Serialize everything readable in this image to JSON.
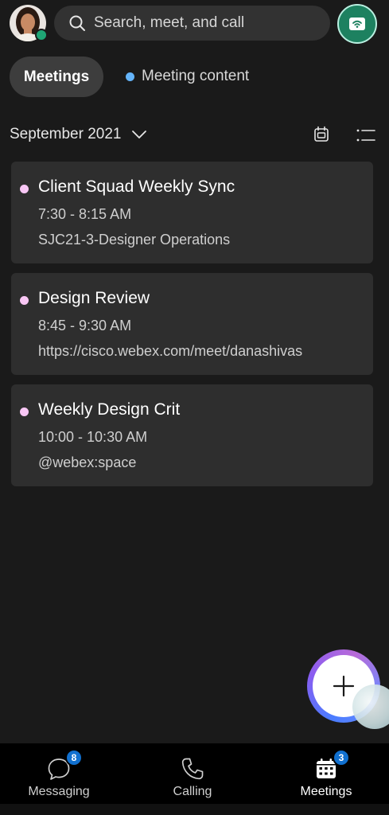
{
  "header": {
    "search_placeholder": "Search, meet, and call"
  },
  "tabs": {
    "meetings_label": "Meetings",
    "content_label": "Meeting content"
  },
  "calendar": {
    "month_label": "September 2021"
  },
  "meetings": [
    {
      "title": "Client Squad Weekly Sync",
      "time": "7:30 - 8:15 AM",
      "location": "SJC21-3-Designer Operations"
    },
    {
      "title": "Design Review",
      "time": "8:45 - 9:30 AM",
      "location": "https://cisco.webex.com/meet/danashivas"
    },
    {
      "title": "Weekly Design Crit",
      "time": "10:00 - 10:30 AM",
      "location": "@webex:space"
    }
  ],
  "bottom_nav": {
    "messaging_label": "Messaging",
    "messaging_badge": "8",
    "calling_label": "Calling",
    "meetings_label": "Meetings",
    "meetings_badge": "3"
  },
  "colors": {
    "background": "#1a1a1a",
    "card": "#2e2e2e",
    "meeting_dot": "#f9c7f5",
    "content_dot": "#64b4fa",
    "presence": "#1fa575",
    "badge": "#1170cf",
    "connect_button": "#1d8160"
  },
  "icons": {
    "search": "search-icon",
    "connect": "device-connect-icon",
    "chevron": "chevron-down-icon",
    "calendar_view": "calendar-icon",
    "list_view": "list-icon",
    "add": "plus-icon",
    "messaging": "chat-bubble-icon",
    "calling": "phone-icon",
    "meetings": "calendar-grid-icon"
  }
}
